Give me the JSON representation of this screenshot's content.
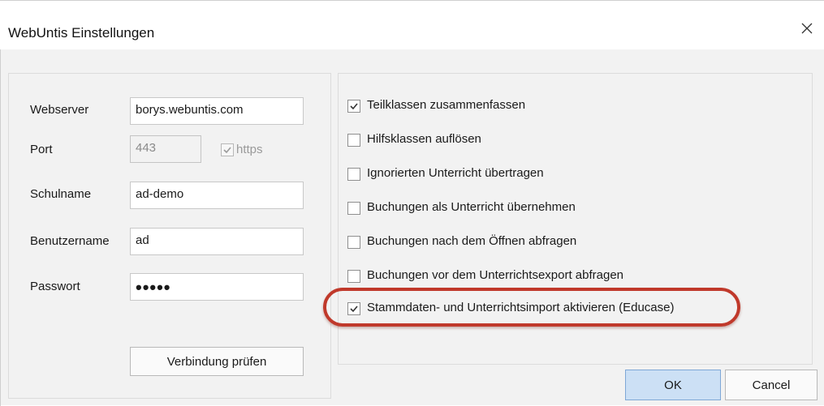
{
  "window": {
    "title": "WebUntis Einstellungen",
    "close_icon": "close-icon"
  },
  "connection": {
    "webserver_label": "Webserver",
    "webserver_value": "borys.webuntis.com",
    "port_label": "Port",
    "port_value": "443",
    "https_label": "https",
    "https_checked": true,
    "schulname_label": "Schulname",
    "schulname_value": "ad-demo",
    "benutzername_label": "Benutzername",
    "benutzername_value": "ad",
    "passwort_label": "Passwort",
    "passwort_value": "•••••",
    "verify_button": "Verbindung prüfen"
  },
  "options": [
    {
      "label": "Teilklassen zusammenfassen",
      "checked": true
    },
    {
      "label": "Hilfsklassen auflösen",
      "checked": false
    },
    {
      "label": "Ignorierten Unterricht übertragen",
      "checked": false
    },
    {
      "label": "Buchungen als Unterricht übernehmen",
      "checked": false
    },
    {
      "label": "Buchungen nach dem Öffnen abfragen",
      "checked": false
    },
    {
      "label": "Buchungen vor dem Unterrichtsexport abfragen",
      "checked": false
    },
    {
      "label": "Stammdaten- und Unterrichtsimport aktivieren (Educase)",
      "checked": true
    }
  ],
  "footer": {
    "ok_label": "OK",
    "cancel_label": "Cancel"
  },
  "colors": {
    "highlight_ring": "#c0392b",
    "ok_button": "#cce0f5"
  }
}
